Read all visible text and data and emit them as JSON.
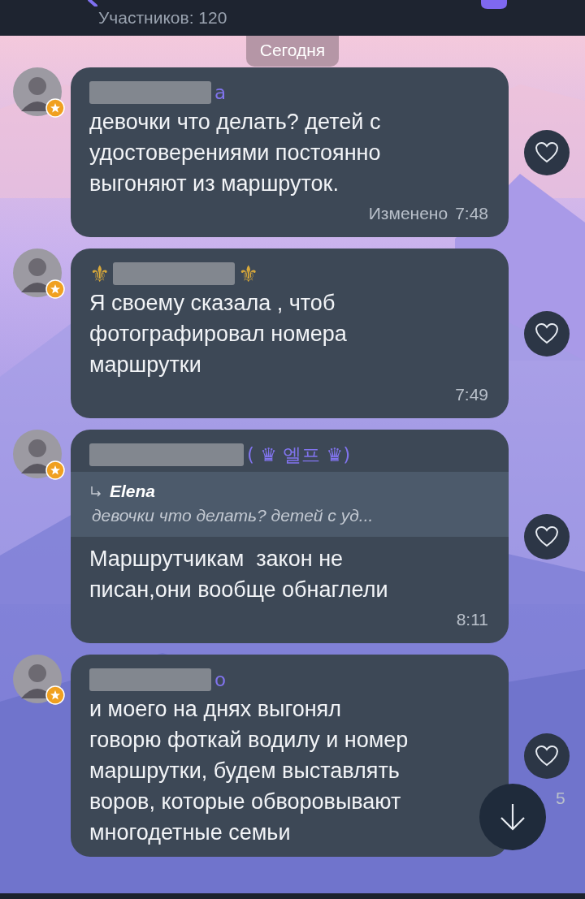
{
  "header": {
    "subtitle": "Участников: 120"
  },
  "date_pill": "Сегодня",
  "messages": [
    {
      "author": [
        {
          "kind": "redacted"
        },
        {
          "kind": "text",
          "text": "a"
        }
      ],
      "text": "девочки что делать? детей с\nудостоверениями постоянно\nвыгоняют из маршруток.",
      "edited": "Изменено",
      "time": "7:48"
    },
    {
      "author": [
        {
          "kind": "ornament",
          "text": "⚜"
        },
        {
          "kind": "redacted"
        },
        {
          "kind": "ornament",
          "text": "⚜"
        }
      ],
      "text": "Я своему сказала , чтоб\nфотографировал номера\nмаршрутки",
      "time": "7:49"
    },
    {
      "author": [
        {
          "kind": "redacted"
        },
        {
          "kind": "text",
          "text": "( ♛ 엘프 ♛)"
        }
      ],
      "reply": {
        "author": "Elena",
        "text": "девочки что делать? детей с уд..."
      },
      "text": "Маршрутчикам  закон не\nписан,они вообще обнаглели",
      "time": "8:11"
    },
    {
      "author": [
        {
          "kind": "redacted"
        },
        {
          "kind": "text",
          "text": "o"
        }
      ],
      "text": "и моего на днях выгонял\nговорю фоткай водилу и номер\nмаршрутки, будем выставлять\nворов, которые обворовывают\nмногодетные семьи",
      "likes": "5"
    }
  ]
}
